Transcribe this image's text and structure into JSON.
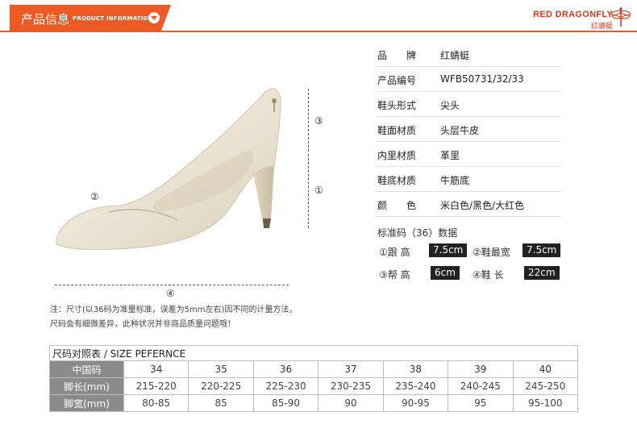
{
  "header": {
    "title": "产品信息",
    "subtitle": "PRODUCT INFORMATION",
    "brand_en": "RED DRAGONFLY",
    "brand_cn": "红蜻蜓"
  },
  "dimensions": {
    "d1": "①",
    "d2": "②",
    "d3": "③",
    "d4": "④"
  },
  "specs": [
    {
      "key": "品　　牌",
      "value": "红蜻蜓"
    },
    {
      "key": "产品编号",
      "value": "WFB50731/32/33"
    },
    {
      "key": "鞋头形式",
      "value": "尖头"
    },
    {
      "key": "鞋面材质",
      "value": "头层牛皮"
    },
    {
      "key": "内里材质",
      "value": "革里"
    },
    {
      "key": "鞋底材质",
      "value": "牛筋底"
    },
    {
      "key": "颜　　色",
      "value": "米白色/黑色/大红色"
    }
  ],
  "standard": {
    "title": "标准码（36）数据",
    "items": [
      {
        "label": "①跟 高",
        "value": "7.5cm"
      },
      {
        "label": "②鞋最宽",
        "value": "7.5cm"
      },
      {
        "label": "③帮 高",
        "value": "6cm"
      },
      {
        "label": "④鞋 长",
        "value": "22cm"
      }
    ]
  },
  "note": {
    "line1": "注：尺寸(以36码为准量标准，误差为5mm左右)因不同的计量方法，",
    "line2": "尺码会有细微差异，此种状况并非商品质量问题哦！"
  },
  "size_table": {
    "caption": "尺码对照表 / SIZE PEFERNCE",
    "header_label": "中国码",
    "sizes": [
      "34",
      "35",
      "36",
      "37",
      "38",
      "39",
      "40"
    ],
    "length_label": "脚长(mm)",
    "lengths": [
      "215-220",
      "220-225",
      "225-230",
      "230-235",
      "235-240",
      "240-245",
      "245-250"
    ],
    "width_label": "脚宽(mm)",
    "widths": [
      "80-85",
      "85",
      "85-90",
      "90",
      "90-95",
      "95",
      "95-100"
    ]
  },
  "colors": {
    "accent": "#ee5a24",
    "shoe": "#efe8d8",
    "value_bg": "#222222",
    "row_header_bg": "#8a8a8a"
  }
}
